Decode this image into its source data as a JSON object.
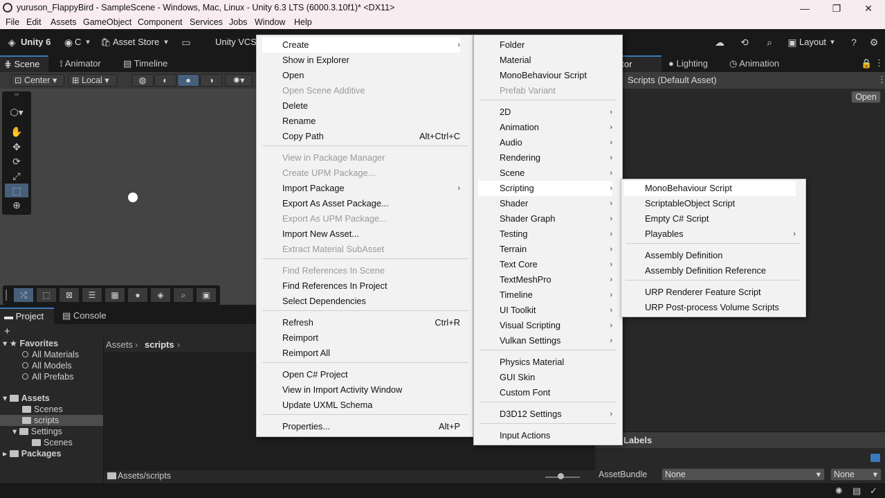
{
  "window": {
    "title": "yuruson_FlappyBird - SampleScene - Windows, Mac, Linux - Unity 6.3 LTS (6000.3.10f1)* <DX11>",
    "minimize": "—",
    "maximize": "❐",
    "close": "✕"
  },
  "menubar": [
    "File",
    "Edit",
    "Assets",
    "GameObject",
    "Component",
    "Services",
    "Jobs",
    "Window",
    "Help"
  ],
  "toolbar": {
    "unity_label": "Unity 6",
    "account_label": "C",
    "asset_store": "Asset Store",
    "vcs": "Unity VCS",
    "layout": "Layout"
  },
  "scene": {
    "tabs": [
      "Scene",
      "Animator",
      "Timeline"
    ],
    "pivot": "Center",
    "space": "Local"
  },
  "project": {
    "tabs": [
      "Project",
      "Console"
    ],
    "tree": {
      "favorites": "Favorites",
      "fav_items": [
        "All Materials",
        "All Models",
        "All Prefabs"
      ],
      "assets": "Assets",
      "asset_items": [
        "Scenes",
        "scripts",
        "Settings",
        "Scenes"
      ],
      "packages": "Packages"
    },
    "breadcrumb": [
      "Assets",
      "scripts"
    ],
    "status_path": "Assets/scripts"
  },
  "inspector": {
    "tabs": [
      "Inspector",
      "Lighting",
      "Animation"
    ],
    "header": "Scripts (Default Asset)",
    "open_button": "Open",
    "labels": "Labels",
    "assetbundle_label": "AssetBundle",
    "assetbundle_value": "None",
    "variant_value": "None"
  },
  "context_menu": {
    "items": [
      {
        "label": "Create",
        "submenu": true
      },
      {
        "label": "Show in Explorer"
      },
      {
        "label": "Open"
      },
      {
        "label": "Open Scene Additive",
        "disabled": true
      },
      {
        "label": "Delete"
      },
      {
        "label": "Rename"
      },
      {
        "label": "Copy Path",
        "shortcut": "Alt+Ctrl+C"
      },
      {
        "label": "View in Package Manager",
        "disabled": true
      },
      {
        "label": "Create UPM Package...",
        "disabled": true
      },
      {
        "label": "Import Package",
        "submenu": true
      },
      {
        "label": "Export As Asset Package..."
      },
      {
        "label": "Export As UPM Package...",
        "disabled": true
      },
      {
        "label": "Import New Asset..."
      },
      {
        "label": "Extract Material SubAsset",
        "disabled": true
      },
      {
        "label": "Find References In Scene",
        "disabled": true
      },
      {
        "label": "Find References In Project"
      },
      {
        "label": "Select Dependencies"
      },
      {
        "label": "Refresh",
        "shortcut": "Ctrl+R"
      },
      {
        "label": "Reimport"
      },
      {
        "label": "Reimport All"
      },
      {
        "label": "Open C# Project"
      },
      {
        "label": "View in Import Activity Window"
      },
      {
        "label": "Update UXML Schema"
      },
      {
        "label": "Properties...",
        "shortcut": "Alt+P"
      }
    ]
  },
  "create_menu": {
    "items": [
      {
        "label": "Folder"
      },
      {
        "label": "Material"
      },
      {
        "label": "MonoBehaviour Script"
      },
      {
        "label": "Prefab Variant",
        "disabled": true
      },
      {
        "label": "2D",
        "submenu": true
      },
      {
        "label": "Animation",
        "submenu": true
      },
      {
        "label": "Audio",
        "submenu": true
      },
      {
        "label": "Rendering",
        "submenu": true
      },
      {
        "label": "Scene",
        "submenu": true
      },
      {
        "label": "Scripting",
        "submenu": true
      },
      {
        "label": "Shader",
        "submenu": true
      },
      {
        "label": "Shader Graph",
        "submenu": true
      },
      {
        "label": "Testing",
        "submenu": true
      },
      {
        "label": "Terrain",
        "submenu": true
      },
      {
        "label": "Text Core",
        "submenu": true
      },
      {
        "label": "TextMeshPro",
        "submenu": true
      },
      {
        "label": "Timeline",
        "submenu": true
      },
      {
        "label": "UI Toolkit",
        "submenu": true
      },
      {
        "label": "Visual Scripting",
        "submenu": true
      },
      {
        "label": "Vulkan Settings",
        "submenu": true
      },
      {
        "label": "Physics Material"
      },
      {
        "label": "GUI Skin"
      },
      {
        "label": "Custom Font"
      },
      {
        "label": "D3D12 Settings",
        "submenu": true
      },
      {
        "label": "Input Actions"
      }
    ]
  },
  "scripting_menu": {
    "items": [
      {
        "label": "MonoBehaviour Script"
      },
      {
        "label": "ScriptableObject Script"
      },
      {
        "label": "Empty C# Script"
      },
      {
        "label": "Playables",
        "submenu": true
      },
      {
        "label": "Assembly Definition"
      },
      {
        "label": "Assembly Definition Reference"
      },
      {
        "label": "URP Renderer Feature Script"
      },
      {
        "label": "URP Post-process Volume Scripts"
      }
    ]
  },
  "icons": {
    "submenu_arrow": "›",
    "dropdown_arrow": "▾"
  },
  "colors": {
    "accent": "#3a79bb",
    "selected": "#46607c",
    "menu_bg": "#f2f2f2"
  }
}
